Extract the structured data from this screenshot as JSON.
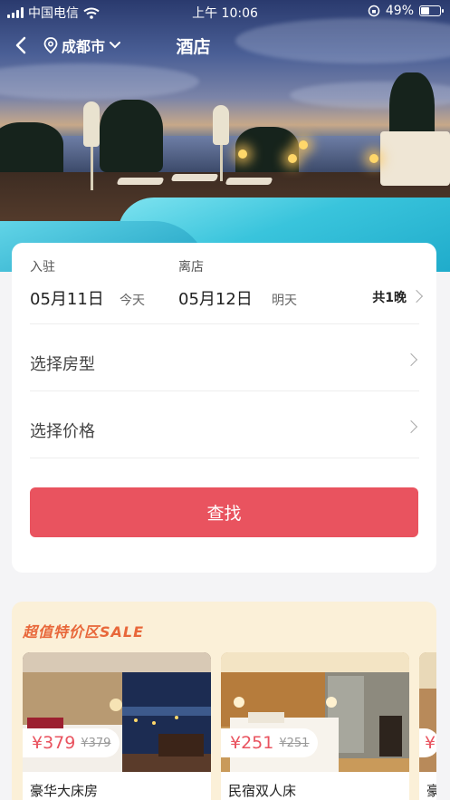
{
  "status_bar": {
    "carrier": "中国电信",
    "time": "上午 10:06",
    "battery": "49%",
    "battery_level": 0.49
  },
  "nav": {
    "city": "成都市",
    "title": "酒店"
  },
  "booking": {
    "checkin_label": "入驻",
    "checkin_date": "05月11日",
    "checkin_day": "今天",
    "checkout_label": "离店",
    "checkout_date": "05月12日",
    "checkout_day": "明天",
    "nights": "共1晚",
    "room_type_label": "选择房型",
    "price_label": "选择价格",
    "search_button": "查找"
  },
  "sale": {
    "title": "超值特价区SALE",
    "rooms": [
      {
        "name": "豪华大床房",
        "price": "¥379",
        "original_price": "¥379"
      },
      {
        "name": "民宿双人床",
        "price": "¥251",
        "original_price": "¥251"
      },
      {
        "name": "豪",
        "price": "¥",
        "original_price": ""
      }
    ]
  },
  "colors": {
    "accent": "#e9535f",
    "sale_title": "#e8673a",
    "sale_bg": "#fbf0d8"
  }
}
